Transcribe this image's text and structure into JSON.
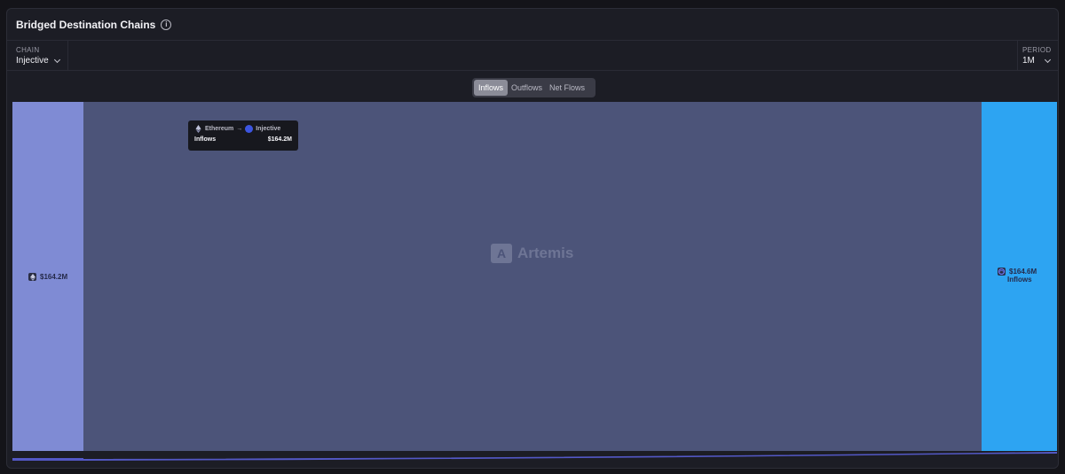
{
  "header": {
    "title": "Bridged Destination Chains",
    "info_icon": "info-icon",
    "info_glyph": "i"
  },
  "filters": {
    "chain": {
      "label": "CHAIN",
      "value": "Injective"
    },
    "period": {
      "label": "PERIOD",
      "value": "1M"
    }
  },
  "toggle": {
    "options": [
      "Inflows",
      "Outflows",
      "Net Flows"
    ],
    "active": "Inflows"
  },
  "chart_data": {
    "type": "sankey",
    "nodes": [
      {
        "name": "Ethereum",
        "label": "$164.2M",
        "icon": "ethereum-icon",
        "color": "#7f8bd4"
      },
      {
        "name": "Injective",
        "label": "$164.6M",
        "sublabel": "Inflows",
        "icon": "injective-icon",
        "color": "#2da4f2"
      }
    ],
    "links": [
      {
        "source": "Ethereum",
        "target": "Injective",
        "value": 164.2,
        "unit": "$M"
      }
    ]
  },
  "tooltip": {
    "source": "Ethereum",
    "arrow": "→",
    "target": "Injective",
    "metric": "Inflows",
    "value": "$164.2M"
  },
  "watermark": {
    "text": "Artemis",
    "logo_glyph": "A"
  },
  "colors": {
    "card_bg": "#1c1d25",
    "flow": "#4c5479",
    "source_node": "#7f8bd4",
    "target_node": "#2da4f2"
  }
}
